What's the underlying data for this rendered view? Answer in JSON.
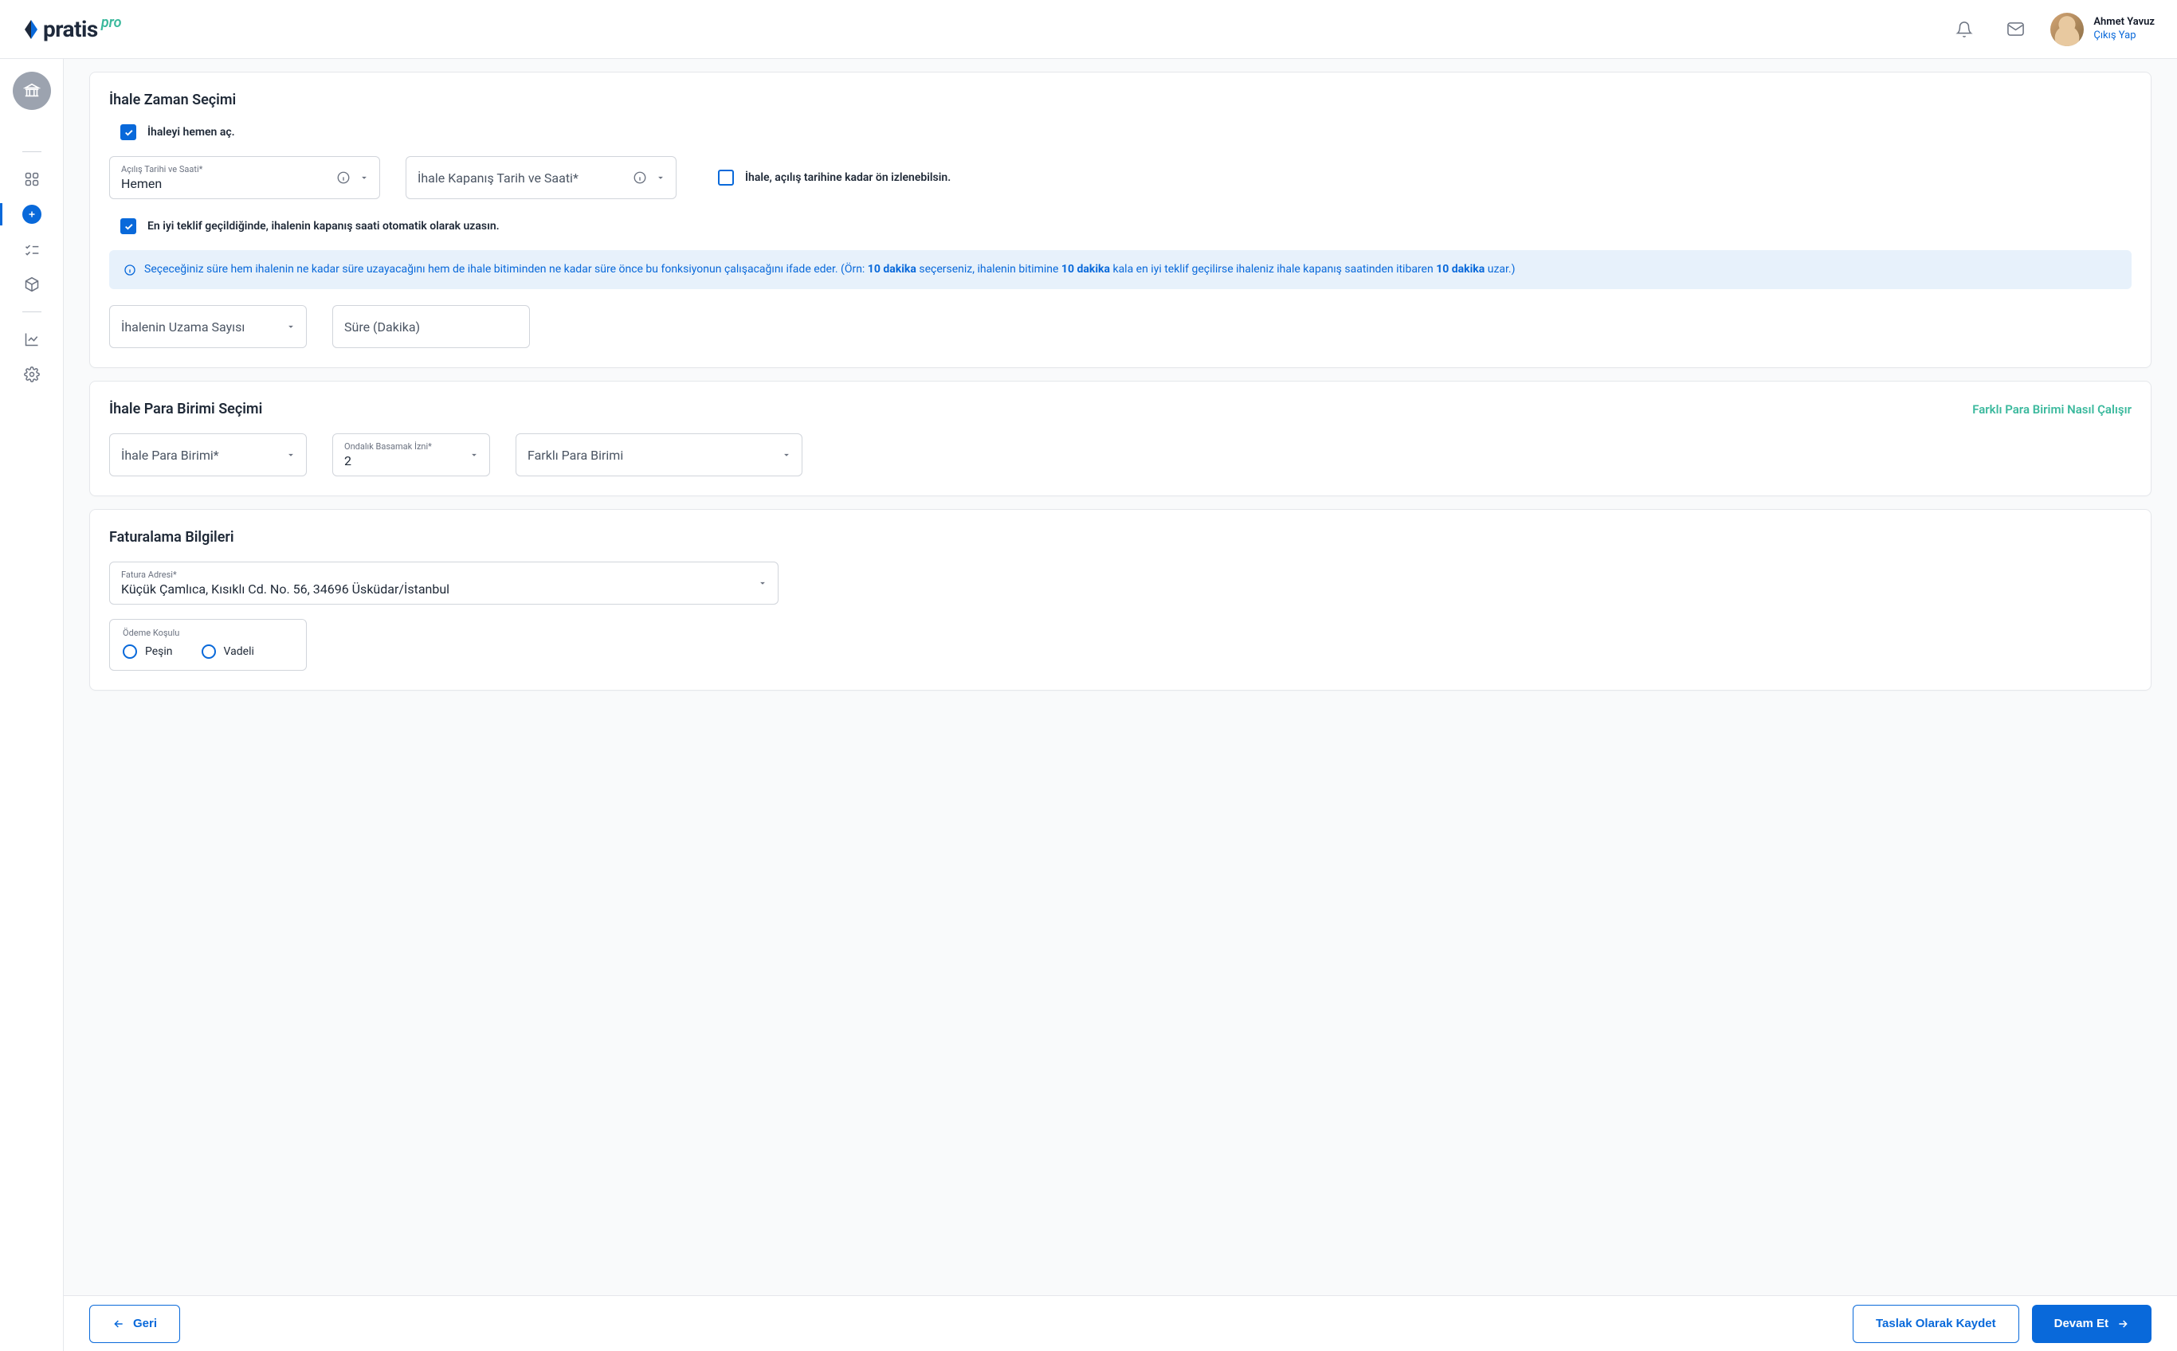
{
  "header": {
    "logo_text": "pratis",
    "logo_pro": "pro",
    "user_name": "Ahmet Yavuz",
    "logout_label": "Çıkış Yap"
  },
  "section_time": {
    "title": "İhale Zaman Seçimi",
    "open_now_label": "İhaleyi hemen aç.",
    "open_date_label": "Açılış Tarihi ve Saati*",
    "open_date_value": "Hemen",
    "close_date_label": "İhale Kapanış Tarih ve Saati*",
    "previewable_label": "İhale, açılış tarihine kadar ön izlenebilsin.",
    "auto_extend_label": "En iyi teklif geçildiğinde, ihalenin kapanış saati otomatik olarak uzasın.",
    "info_part1": "Seçeceğiniz süre hem ihalenin ne kadar süre uzayacağını hem de ihale bitiminden ne kadar süre önce bu fonksiyonun çalışacağını ifade eder. (Örn: ",
    "info_bold1": "10 dakika",
    "info_part2": " seçerseniz, ihalenin bitimine ",
    "info_bold2": "10 dakika",
    "info_part3": " kala en iyi teklif geçilirse ihaleniz ihale kapanış saatinden itibaren ",
    "info_bold3": "10 dakika",
    "info_part4": " uzar.)",
    "extend_count_placeholder": "İhalenin Uzama Sayısı",
    "duration_placeholder": "Süre (Dakika)"
  },
  "section_currency": {
    "title": "İhale Para Birimi Seçimi",
    "help_link": "Farklı Para Birimi Nasıl Çalışır",
    "currency_placeholder": "İhale Para Birimi*",
    "decimals_label": "Ondalık Basamak İzni*",
    "decimals_value": "2",
    "other_currency_placeholder": "Farklı Para Birimi"
  },
  "section_billing": {
    "title": "Faturalama Bilgileri",
    "address_label": "Fatura Adresi*",
    "address_value": "Küçük Çamlıca, Kısıklı Cd. No. 56, 34696 Üsküdar/İstanbul",
    "payment_label": "Ödeme Koşulu",
    "payment_opts": [
      "Peşin",
      "Vadeli"
    ]
  },
  "footer": {
    "back": "Geri",
    "save_draft": "Taslak Olarak Kaydet",
    "continue": "Devam Et"
  }
}
